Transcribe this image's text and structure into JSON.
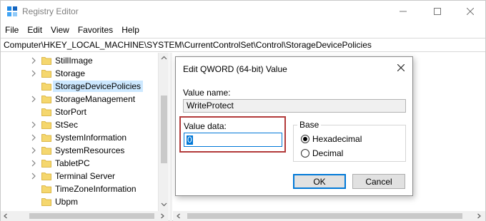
{
  "window": {
    "title": "Registry Editor"
  },
  "menu": [
    {
      "label": "File"
    },
    {
      "label": "Edit"
    },
    {
      "label": "View"
    },
    {
      "label": "Favorites"
    },
    {
      "label": "Help"
    }
  ],
  "address": "Computer\\HKEY_LOCAL_MACHINE\\SYSTEM\\CurrentControlSet\\Control\\StorageDevicePolicies",
  "tree": [
    {
      "label": "StillImage",
      "expandable": true
    },
    {
      "label": "Storage",
      "expandable": true
    },
    {
      "label": "StorageDevicePolicies",
      "expandable": false,
      "selected": true
    },
    {
      "label": "StorageManagement",
      "expandable": true
    },
    {
      "label": "StorPort",
      "expandable": false
    },
    {
      "label": "StSec",
      "expandable": true
    },
    {
      "label": "SystemInformation",
      "expandable": true
    },
    {
      "label": "SystemResources",
      "expandable": true
    },
    {
      "label": "TabletPC",
      "expandable": true
    },
    {
      "label": "Terminal Server",
      "expandable": true
    },
    {
      "label": "TimeZoneInformation",
      "expandable": false
    },
    {
      "label": "Ubpm",
      "expandable": false
    }
  ],
  "dialog": {
    "title": "Edit QWORD (64-bit) Value",
    "value_name_label": "Value name:",
    "value_name": "WriteProtect",
    "value_data_label": "Value data:",
    "value_data": "0",
    "base_label": "Base",
    "radio_hex": "Hexadecimal",
    "radio_dec": "Decimal",
    "selected_base": "Hexadecimal",
    "ok_label": "OK",
    "cancel_label": "Cancel"
  },
  "colors": {
    "folder": "#f5d76e",
    "selection": "#cce8ff",
    "highlight": "#b23a3a",
    "accent": "#0078d7"
  }
}
